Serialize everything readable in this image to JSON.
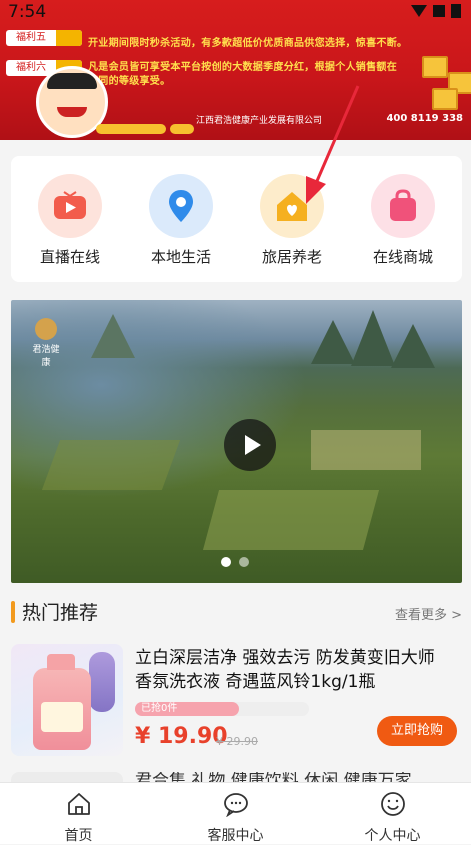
{
  "status_bar": {
    "time": "7:54"
  },
  "banner": {
    "tags": [
      "福利五",
      "福利六"
    ],
    "lines": [
      "开业期间限时秒杀活动，有多款超低价优质商品供您选择，惊喜不断。",
      "凡是会员皆可享受本平台按创的大数据季度分红，根据个人销售额在",
      "不同的等级享受。"
    ],
    "company": "江西君浩健康产业发展有限公司",
    "phone": "400 8119 338"
  },
  "categories": [
    {
      "label": "直播在线",
      "icon": "play-tv-icon",
      "color": "#f25c4c",
      "bg": "#fde3dc"
    },
    {
      "label": "本地生活",
      "icon": "location-pin-icon",
      "color": "#2f8bea",
      "bg": "#dbeafb"
    },
    {
      "label": "旅居养老",
      "icon": "house-heart-icon",
      "color": "#f5b020",
      "bg": "#fdeccb"
    },
    {
      "label": "在线商城",
      "icon": "shopping-bag-icon",
      "color": "#f0527a",
      "bg": "#fde0e6"
    }
  ],
  "video": {
    "logo_text": "君浩健康",
    "slides_total": 2,
    "active_slide": 0
  },
  "hot": {
    "title": "热门推荐",
    "more": "查看更多 >"
  },
  "products": [
    {
      "name": "立白深层洁净 强效去污 防发黄变旧大师香氛洗衣液 奇遇蓝风铃1kg/1瓶",
      "sold_text": "已抢0件",
      "progress": 0.6,
      "price": "¥ 19.90",
      "old_price": "¥ 29.90",
      "buy_label": "立即抢购"
    }
  ],
  "next_product_partial": "君合集 礼物 健康饮料 休闲 健康万家",
  "tabbar": [
    {
      "label": "首页",
      "icon": "home-icon"
    },
    {
      "label": "客服中心",
      "icon": "chat-bubble-icon"
    },
    {
      "label": "个人中心",
      "icon": "smile-face-icon"
    }
  ],
  "colors": {
    "accent": "#f05a12",
    "price": "#e8412b",
    "bar": "#f29a1e"
  }
}
